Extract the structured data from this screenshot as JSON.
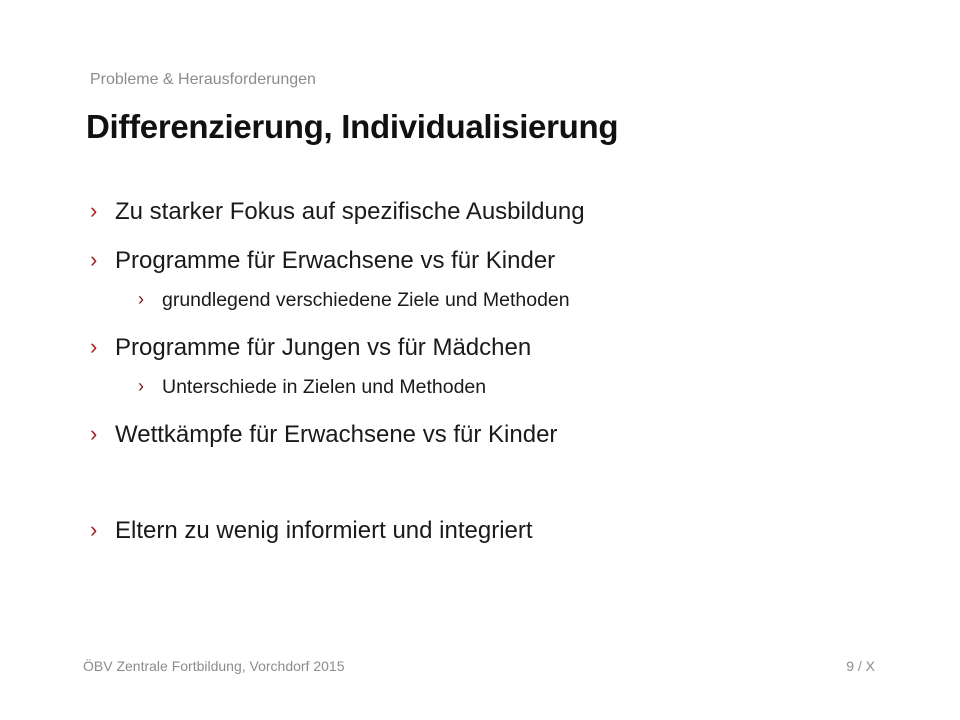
{
  "slide": {
    "overline": "Probleme & Herausforderungen",
    "title": "Differenzierung, Individualisierung",
    "bullet_marker": "›",
    "bullets": [
      {
        "text": "Zu starker Fokus auf spezifische Ausbildung"
      },
      {
        "text": "Programme für Erwachsene vs für Kinder"
      },
      {
        "text": "grundlegend verschiedene Ziele und Methoden"
      },
      {
        "text": "Programme für Jungen vs für Mädchen"
      },
      {
        "text": "Unterschiede in Zielen und Methoden"
      },
      {
        "text": "Wettkämpfe für Erwachsene vs für Kinder"
      },
      {
        "text": "Eltern zu wenig informiert und integriert"
      }
    ],
    "colors": {
      "accent_marker": "#a51e22",
      "muted_text": "#8c8c8c",
      "body_text": "#1a1a1a"
    }
  },
  "footer": {
    "left": "ÖBV Zentrale Fortbildung, Vorchdorf 2015",
    "right": "9 / X"
  }
}
